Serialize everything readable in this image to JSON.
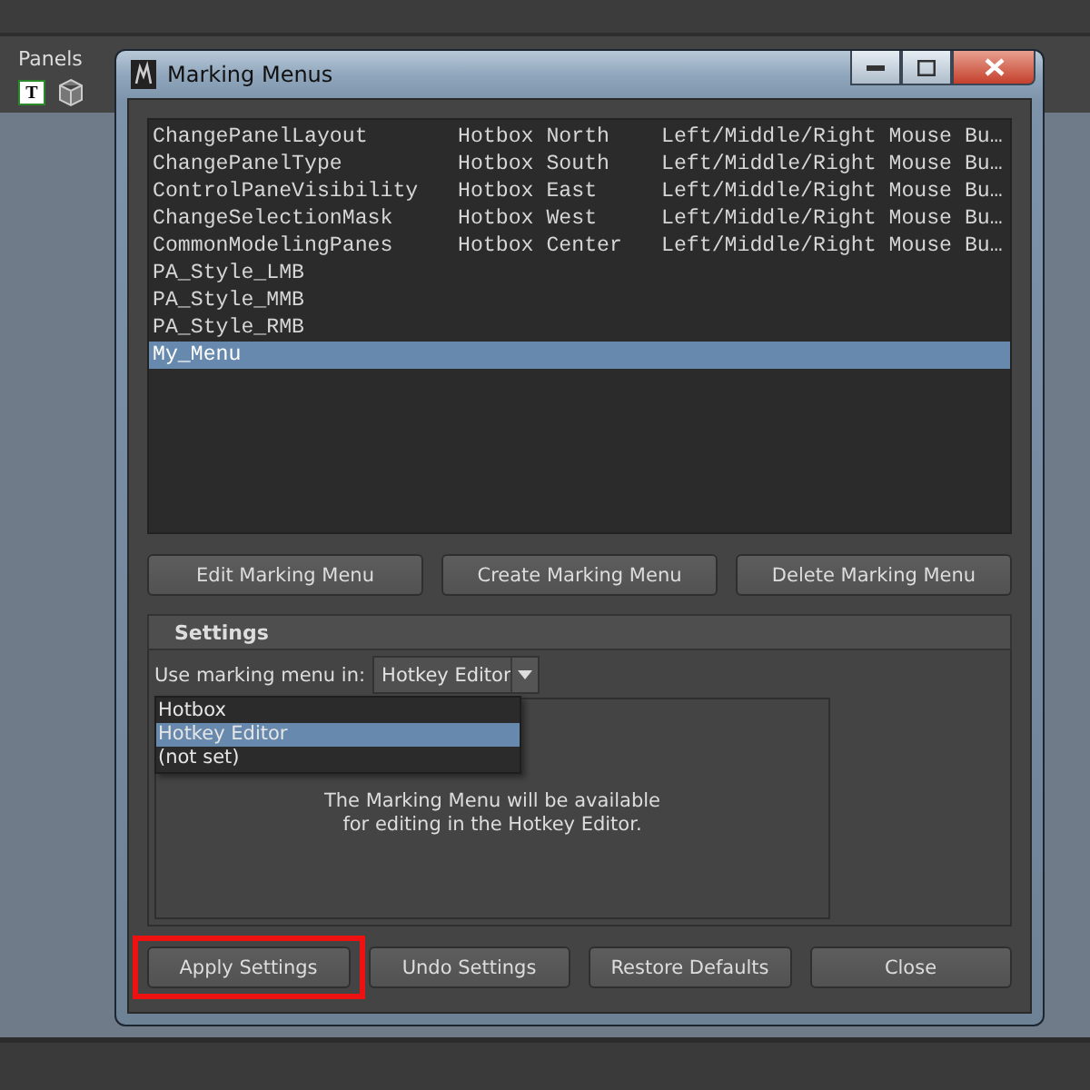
{
  "app": {
    "panel_menu": "Panels",
    "toolbar_letter": "T"
  },
  "window": {
    "title": "Marking Menus"
  },
  "menus": [
    {
      "name": "ChangePanelLayout",
      "location": "Hotbox North",
      "button": "Left/Middle/Right Mouse Bu…",
      "selected": false
    },
    {
      "name": "ChangePanelType",
      "location": "Hotbox South",
      "button": "Left/Middle/Right Mouse Bu…",
      "selected": false
    },
    {
      "name": "ControlPaneVisibility",
      "location": "Hotbox East",
      "button": "Left/Middle/Right Mouse Bu…",
      "selected": false
    },
    {
      "name": "ChangeSelectionMask",
      "location": "Hotbox West",
      "button": "Left/Middle/Right Mouse Bu…",
      "selected": false
    },
    {
      "name": "CommonModelingPanes",
      "location": "Hotbox Center",
      "button": "Left/Middle/Right Mouse Bu…",
      "selected": false
    },
    {
      "name": "PA_Style_LMB",
      "selected": false
    },
    {
      "name": "PA_Style_MMB",
      "selected": false
    },
    {
      "name": "PA_Style_RMB",
      "selected": false
    },
    {
      "name": "My_Menu",
      "selected": true
    }
  ],
  "actions": [
    "Edit Marking Menu",
    "Create Marking Menu",
    "Delete Marking Menu"
  ],
  "settings": {
    "title": "Settings",
    "label": "Use marking menu in:",
    "value": "Hotkey Editor",
    "expanded": true,
    "options": [
      {
        "label": "Hotbox",
        "selected": false
      },
      {
        "label": "Hotkey Editor",
        "selected": true
      },
      {
        "label": "(not set)",
        "selected": false
      }
    ],
    "message_lines": [
      "The Marking Menu will be available",
      "for editing in the Hotkey Editor."
    ]
  },
  "footer_buttons": [
    {
      "label": "Apply Settings",
      "highlighted": true
    },
    {
      "label": "Undo Settings",
      "highlighted": false
    },
    {
      "label": "Restore Defaults",
      "highlighted": false
    },
    {
      "label": "Close",
      "highlighted": false
    }
  ]
}
